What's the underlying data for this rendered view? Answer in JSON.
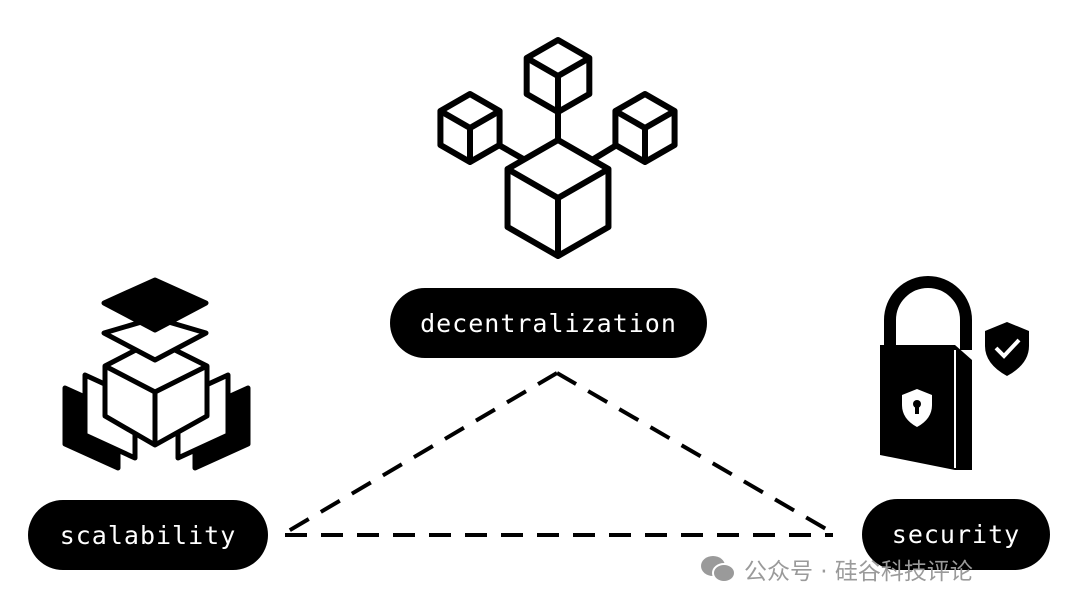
{
  "labels": {
    "top": "decentralization",
    "left": "scalability",
    "right": "security"
  },
  "watermark": {
    "text": "公众号 · 硅谷科技评论",
    "icon": "wechat-icon"
  },
  "icons": {
    "top": "network-cubes-icon",
    "left": "scalability-layers-cube-icon",
    "right": "padlock-shield-icon"
  },
  "colors": {
    "ink": "#000000",
    "background": "#ffffff",
    "watermark": "#9a9a9a"
  }
}
